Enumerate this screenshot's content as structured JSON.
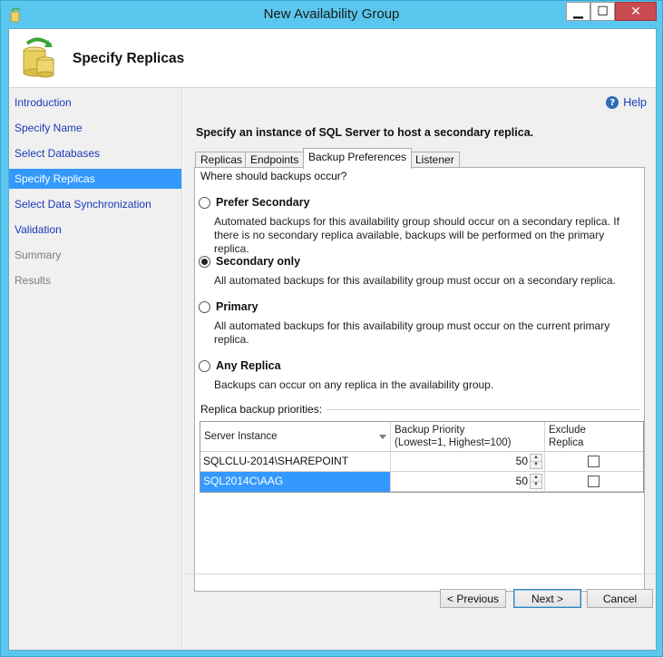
{
  "window": {
    "title": "New Availability Group"
  },
  "header": {
    "title": "Specify Replicas"
  },
  "nav": {
    "items": [
      {
        "label": "Introduction"
      },
      {
        "label": "Specify Name"
      },
      {
        "label": "Select Databases"
      },
      {
        "label": "Specify Replicas"
      },
      {
        "label": "Select Data Synchronization"
      },
      {
        "label": "Validation"
      },
      {
        "label": "Summary"
      },
      {
        "label": "Results"
      }
    ],
    "selected": "Specify Replicas"
  },
  "main": {
    "help_label": "Help",
    "instruction": "Specify an instance of SQL Server to host a secondary replica.",
    "tabs": [
      {
        "label": "Replicas"
      },
      {
        "label": "Endpoints"
      },
      {
        "label": "Backup Preferences"
      },
      {
        "label": "Listener"
      }
    ],
    "active_tab": "Backup Preferences",
    "question": "Where should backups occur?",
    "options": [
      {
        "label": "Prefer Secondary",
        "desc": "Automated backups for this availability group should occur on a secondary replica. If there is no secondary replica available, backups will be performed on the primary replica."
      },
      {
        "label": "Secondary only",
        "desc": "All automated backups for this availability group must occur on a secondary replica."
      },
      {
        "label": "Primary",
        "desc": "All automated backups for this availability group must occur on the current primary replica."
      },
      {
        "label": "Any Replica",
        "desc": "Backups can occur on any replica in the availability group."
      }
    ],
    "selected_option": "Secondary only",
    "priorities_label": "Replica backup priorities:",
    "grid": {
      "headers": {
        "server": "Server Instance",
        "priority_line1": "Backup Priority",
        "priority_line2": "(Lowest=1, Highest=100)",
        "exclude_line1": "Exclude",
        "exclude_line2": "Replica"
      },
      "rows": [
        {
          "server": "SQLCLU-2014\\SHAREPOINT",
          "priority": "50",
          "exclude": false
        },
        {
          "server": "SQL2014C\\AAG",
          "priority": "50",
          "exclude": false
        }
      ]
    }
  },
  "buttons": {
    "previous": "< Previous",
    "next": "Next >",
    "cancel": "Cancel"
  },
  "colors": {
    "selection": "#3399ff",
    "link": "#1b3ab8",
    "titlebar": "#5bc7ef",
    "close": "#c74b50"
  }
}
